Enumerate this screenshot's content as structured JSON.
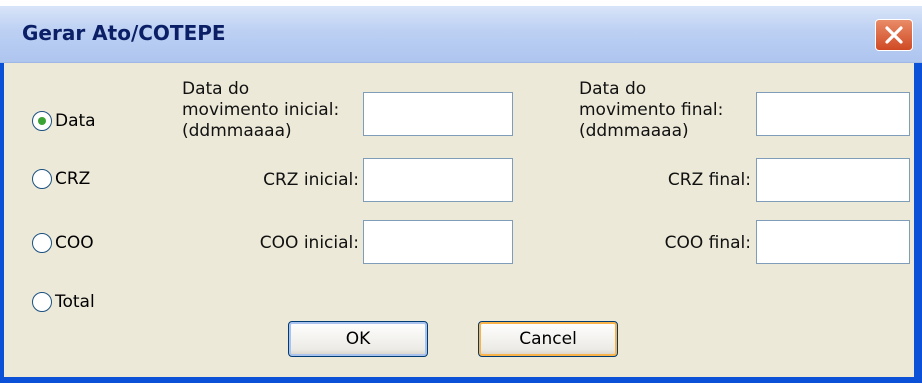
{
  "window": {
    "title": "Gerar Ato/COTEPE"
  },
  "icons": {
    "close": "close-icon"
  },
  "radios": [
    {
      "label": "Data",
      "selected": true
    },
    {
      "label": "CRZ",
      "selected": false
    },
    {
      "label": "COO",
      "selected": false
    },
    {
      "label": "Total",
      "selected": false
    }
  ],
  "fields": {
    "data_inicial": {
      "label_line1": "Data do",
      "label_line2": "movimento inicial:",
      "label_line3": "(ddmmaaaa)",
      "value": ""
    },
    "data_final": {
      "label_line1": "Data do",
      "label_line2": "movimento final:",
      "label_line3": "(ddmmaaaa)",
      "value": ""
    },
    "crz_inicial": {
      "label": "CRZ inicial:",
      "value": ""
    },
    "crz_final": {
      "label": "CRZ final:",
      "value": ""
    },
    "coo_inicial": {
      "label": "COO inicial:",
      "value": ""
    },
    "coo_final": {
      "label": "COO final:",
      "value": ""
    }
  },
  "buttons": {
    "ok": "OK",
    "cancel": "Cancel"
  },
  "colors": {
    "titlebar_text": "#0b1f66",
    "window_border": "#0a51d8",
    "client_bg": "#ece9d8",
    "radio_dot": "#3ba234",
    "close_bg": "#d9582f"
  }
}
